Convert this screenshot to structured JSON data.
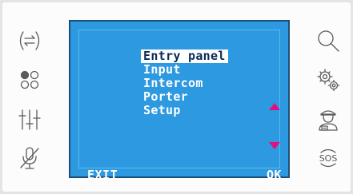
{
  "icons": {
    "left": [
      "intercom-transfer-icon",
      "camera-toggle-icon",
      "settings-sliders-icon",
      "mic-mute-icon"
    ],
    "right": [
      "search-icon",
      "settings-gears-icon",
      "porter-icon",
      "sos-icon"
    ]
  },
  "sos_label": "SOS",
  "menu": {
    "items": [
      "Entry panel",
      "Input",
      "Intercom",
      "Porter",
      "Setup"
    ],
    "selected": "Entry panel"
  },
  "softkeys": {
    "left": "EXIT",
    "right": "OK"
  },
  "colors": {
    "screen": "#2d99e0",
    "highlight": "#ffffff",
    "highlight_text": "#0b2b57",
    "arrow": "#e0107f",
    "icon": "#5a5a5a"
  }
}
